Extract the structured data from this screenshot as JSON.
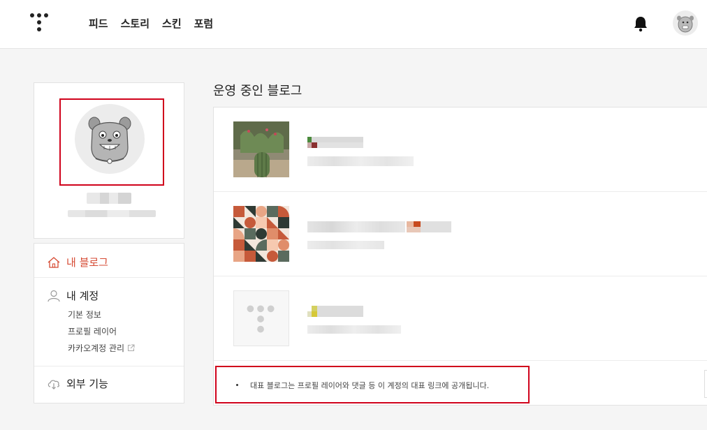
{
  "header": {
    "logo": "tistory-logo-icon",
    "nav": [
      "피드",
      "스토리",
      "스킨",
      "포럼"
    ],
    "icons": {
      "bell": "bell-icon",
      "avatar": "avatar-icon"
    }
  },
  "sidebar": {
    "menu": [
      {
        "label": "내 블로그",
        "icon": "home-icon",
        "active": true
      },
      {
        "label": "내 계정",
        "icon": "user-icon",
        "sub": [
          "기본 정보",
          "프로필 레이어",
          "카카오계정 관리"
        ]
      },
      {
        "label": "외부 기능",
        "icon": "cloud-download-icon"
      }
    ]
  },
  "main": {
    "title": "운영 중인 블로그",
    "notice": "대표 블로그는 프로필 레이어와 댓글 등 이 계정의 대표 링크에 공개됩니다."
  },
  "colors": {
    "accent": "#d64a33",
    "highlight": "#d0021b"
  }
}
